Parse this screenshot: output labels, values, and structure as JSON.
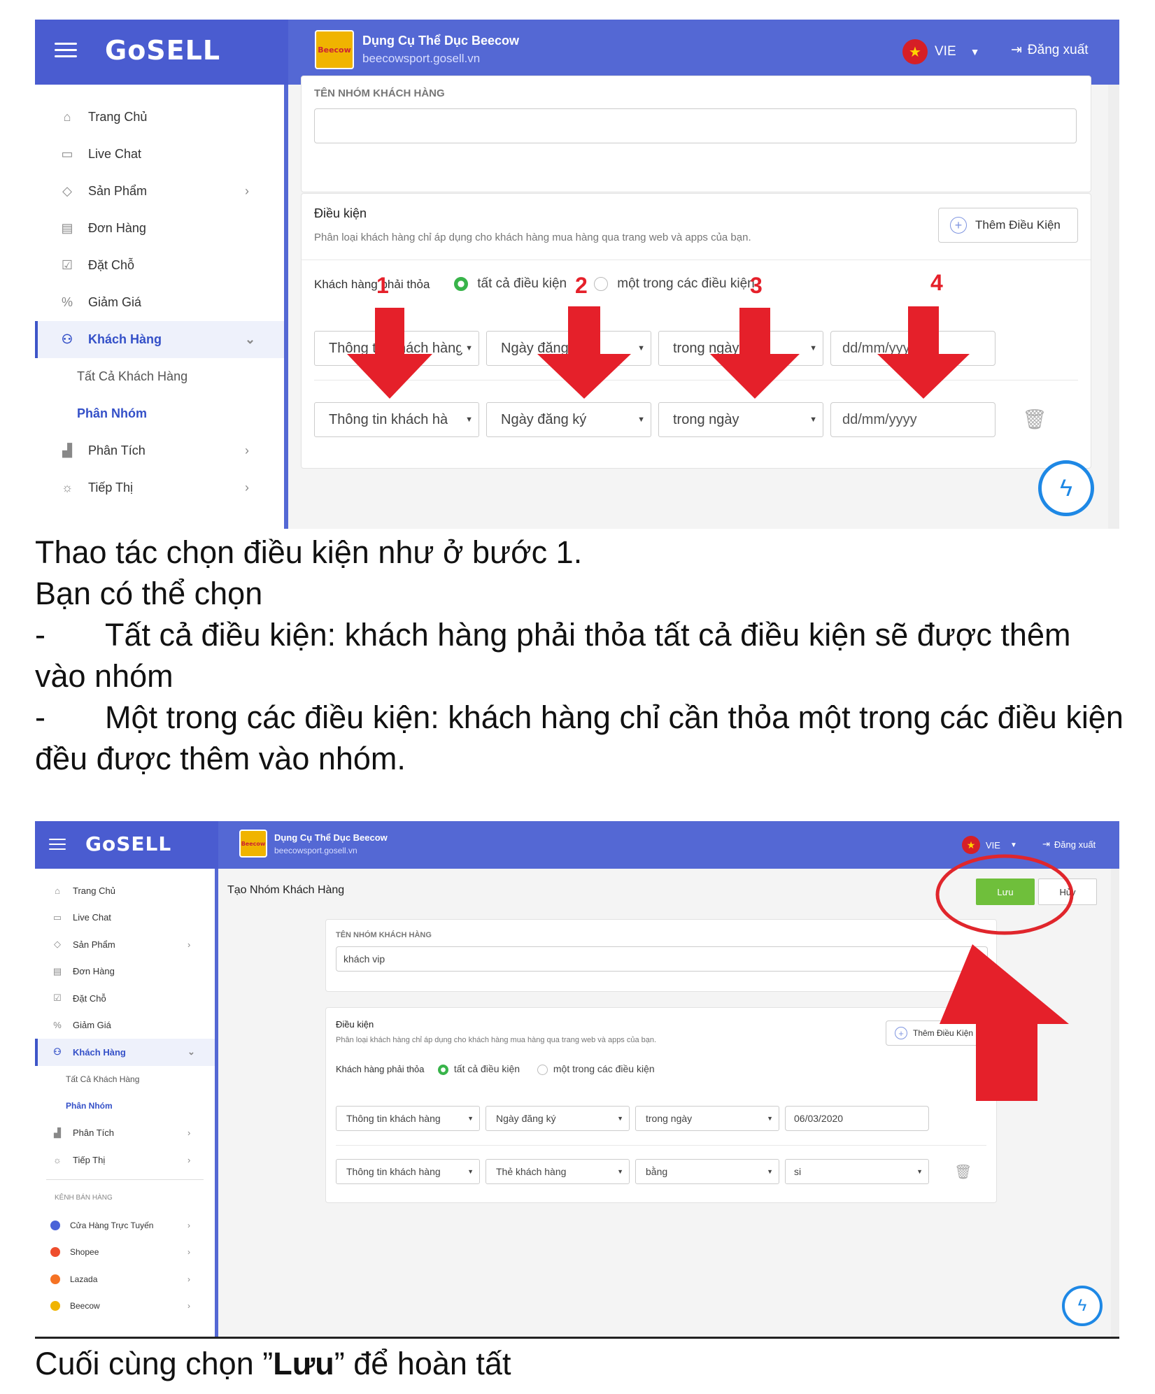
{
  "header": {
    "logo": "GoSELL",
    "shop_name": "Dụng Cụ Thể Dục Beecow",
    "shop_url": "beecowsport.gosell.vn",
    "shop_logo_text": "Beecow",
    "lang": "VIE",
    "logout": "Đăng xuất"
  },
  "sidebar": {
    "items": [
      {
        "label": "Trang Chủ",
        "icon": "home-icon"
      },
      {
        "label": "Live Chat",
        "icon": "chat-icon"
      },
      {
        "label": "Sản Phẩm",
        "icon": "tag-icon"
      },
      {
        "label": "Đơn Hàng",
        "icon": "receipt-icon"
      },
      {
        "label": "Đặt Chỗ",
        "icon": "calendar-icon"
      },
      {
        "label": "Giảm Giá",
        "icon": "discount-icon"
      },
      {
        "label": "Khách Hàng",
        "icon": "users-icon"
      },
      {
        "label": "Tất Cả Khách Hàng"
      },
      {
        "label": "Phân Nhóm"
      },
      {
        "label": "Phân Tích",
        "icon": "chart-icon"
      },
      {
        "label": "Tiếp Thị",
        "icon": "bulb-icon"
      }
    ],
    "channels_title": "KÊNH BÁN HÀNG",
    "channels": [
      {
        "label": "Cửa Hàng Trực Tuyến",
        "color": "#4a63d8"
      },
      {
        "label": "Shopee",
        "color": "#ee4d2d"
      },
      {
        "label": "Lazada",
        "color": "#f57224"
      },
      {
        "label": "Beecow",
        "color": "#f0b400"
      }
    ]
  },
  "form": {
    "page_title": "Tạo Nhóm Khách Hàng",
    "save": "Lưu",
    "cancel": "Hủy",
    "name_label": "TÊN NHÓM KHÁCH HÀNG",
    "name_value": "khách vip",
    "cond_title": "Điều kiện",
    "cond_desc": "Phân loại khách hàng chỉ áp dụng cho khách hàng mua hàng qua trang web và apps của bạn.",
    "add_cond": "Thêm Điều Kiện",
    "must_match": "Khách hàng phải thỏa",
    "opt_all": "tất cả điều kiện",
    "opt_any": "một trong các điều kiện"
  },
  "shot1": {
    "row1": [
      "Thông tin khách hàng",
      "Ngày đăng ký",
      "trong ngày",
      "dd/mm/yyyy"
    ],
    "row2": [
      "Thông tin khách hà",
      "Ngày đăng ký",
      "trong ngày",
      "dd/mm/yyyy"
    ],
    "arrow_numbers": [
      "1",
      "2",
      "3",
      "4"
    ]
  },
  "shot2": {
    "row1": [
      "Thông tin khách hàng",
      "Ngày đăng ký",
      "trong ngày",
      "06/03/2020"
    ],
    "row2": [
      "Thông tin khách hàng",
      "Thẻ khách hàng",
      "bằng",
      "si"
    ]
  },
  "text": {
    "p1": "Thao tác chọn điều kiện như ở bước 1.",
    "p2": "Bạn có thể chọn",
    "b1_dash": "-",
    "b1": "Tất cả điều kiện: khách hàng phải thỏa tất cả điều kiện sẽ được thêm vào nhóm",
    "b2_dash": "-",
    "b2": "Một trong các điều kiện: khách hàng chỉ cần thỏa một trong các điều kiện đều được thêm vào nhóm.",
    "final_pre": "Cuối cùng chọn ”",
    "final_bold": "Lưu",
    "final_post": "” để hoàn tất"
  },
  "colors": {
    "header": "#5468d4",
    "accent": "#3450c8",
    "save": "#6fbf3b",
    "annotation": "#e5202a"
  }
}
